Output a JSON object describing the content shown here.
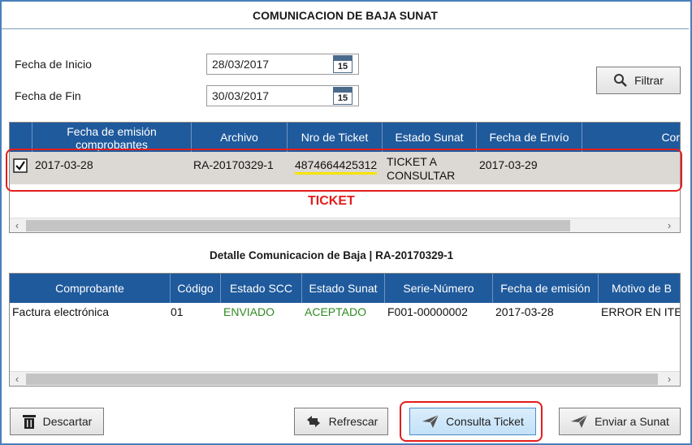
{
  "window": {
    "title": "COMUNICACION DE BAJA SUNAT"
  },
  "filters": {
    "start_label": "Fecha de Inicio",
    "start_value": "28/03/2017",
    "end_label": "Fecha de Fin",
    "end_value": "30/03/2017",
    "calendar_day": "15",
    "filter_button": "Filtrar"
  },
  "top_grid": {
    "columns": [
      "Fecha de emisión comprobantes",
      "Archivo",
      "Nro de Ticket",
      "Estado Sunat",
      "Fecha de Envío",
      "Com"
    ],
    "rows": [
      {
        "checked": true,
        "fecha": "2017-03-28",
        "archivo": "RA-20170329-1",
        "ticket": "4874664425312",
        "estado_l1": "TICKET A",
        "estado_l2": "CONSULTAR",
        "envio": "2017-03-29"
      }
    ]
  },
  "annotation": {
    "ticket_label": "TICKET",
    "color": "#e41d1d",
    "highlight": "#f5e400"
  },
  "detail": {
    "title": "Detalle Comunicacion de Baja | RA-20170329-1",
    "columns": [
      "Comprobante",
      "Código",
      "Estado SCC",
      "Estado Sunat",
      "Serie-Número",
      "Fecha de emisión",
      "Motivo de B"
    ],
    "rows": [
      {
        "comprobante": "Factura electrónica",
        "codigo": "01",
        "estado_scc": "ENVIADO",
        "estado_sunat": "ACEPTADO",
        "serie": "F001-00000002",
        "fecha": "2017-03-28",
        "motivo": "ERROR EN ITE"
      }
    ],
    "status_color": "#2e8b22"
  },
  "actions": {
    "descartar": "Descartar",
    "refrescar": "Refrescar",
    "consulta": "Consulta Ticket",
    "enviar": "Enviar a Sunat"
  },
  "colors": {
    "header_bg": "#1f5a9c",
    "frame": "#4a7ebb",
    "selected_row": "#dcd8d4"
  }
}
